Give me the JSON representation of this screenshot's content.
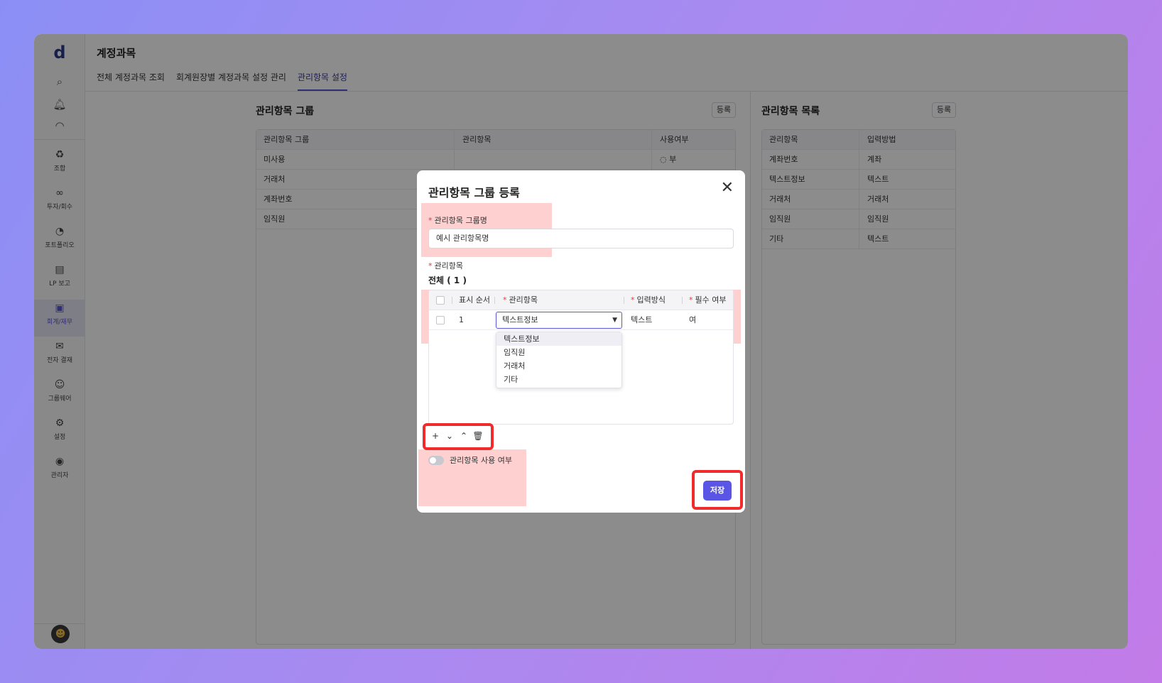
{
  "sidebar": {
    "logo": "d",
    "items": [
      {
        "label": "조합",
        "icon": "recycle-icon"
      },
      {
        "label": "투자/회수",
        "icon": "rings-icon"
      },
      {
        "label": "포트폴리오",
        "icon": "pie-icon"
      },
      {
        "label": "LP 보고",
        "icon": "file-icon"
      },
      {
        "label": "회계/재무",
        "icon": "dollar-doc-icon"
      },
      {
        "label": "전자 결재",
        "icon": "inbox-icon"
      },
      {
        "label": "그룹웨어",
        "icon": "users-icon"
      },
      {
        "label": "설정",
        "icon": "gear-icon"
      },
      {
        "label": "관리자",
        "icon": "headset-icon"
      }
    ]
  },
  "header": {
    "title": "계정과목",
    "tabs": [
      "전체 계정과목 조회",
      "회계원장별 계정과목 설정 관리",
      "관리항목 설정"
    ]
  },
  "left_panel": {
    "title": "관리항목 그룹",
    "register_label": "등록",
    "columns": [
      "관리항목 그룹",
      "관리항목",
      "사용여부"
    ],
    "rows": [
      {
        "group": "미사용",
        "item": "",
        "use": "부"
      },
      {
        "group": "거래처",
        "item": "",
        "use": ""
      },
      {
        "group": "계좌번호",
        "item": "",
        "use": ""
      },
      {
        "group": "임직원",
        "item": "",
        "use": ""
      }
    ]
  },
  "right_panel": {
    "title": "관리항목 목록",
    "register_label": "등록",
    "columns": [
      "관리항목",
      "입력방법"
    ],
    "rows": [
      {
        "item": "계좌번호",
        "method": "계좌"
      },
      {
        "item": "텍스트정보",
        "method": "텍스트"
      },
      {
        "item": "거래처",
        "method": "거래처"
      },
      {
        "item": "임직원",
        "method": "임직원"
      },
      {
        "item": "기타",
        "method": "텍스트"
      }
    ]
  },
  "modal": {
    "title": "관리항목 그룹 등록",
    "group_name_label": "관리항목 그룹명",
    "group_name_value": "예시 관리항목명",
    "items_label": "관리항목",
    "count_text": "전체 ( 1 )",
    "columns": [
      "표시 순서",
      "관리항목",
      "입력방식",
      "필수 여부"
    ],
    "row": {
      "order": "1",
      "item": "텍스트정보",
      "input": "텍스트",
      "required": "여"
    },
    "dropdown_options": [
      "텍스트정보",
      "임직원",
      "거래처",
      "기타"
    ],
    "toggle_label": "관리항목 사용 여부",
    "save_label": "저장"
  },
  "colors": {
    "accent": "#5b55e6",
    "highlight": "#ef2b2b"
  }
}
